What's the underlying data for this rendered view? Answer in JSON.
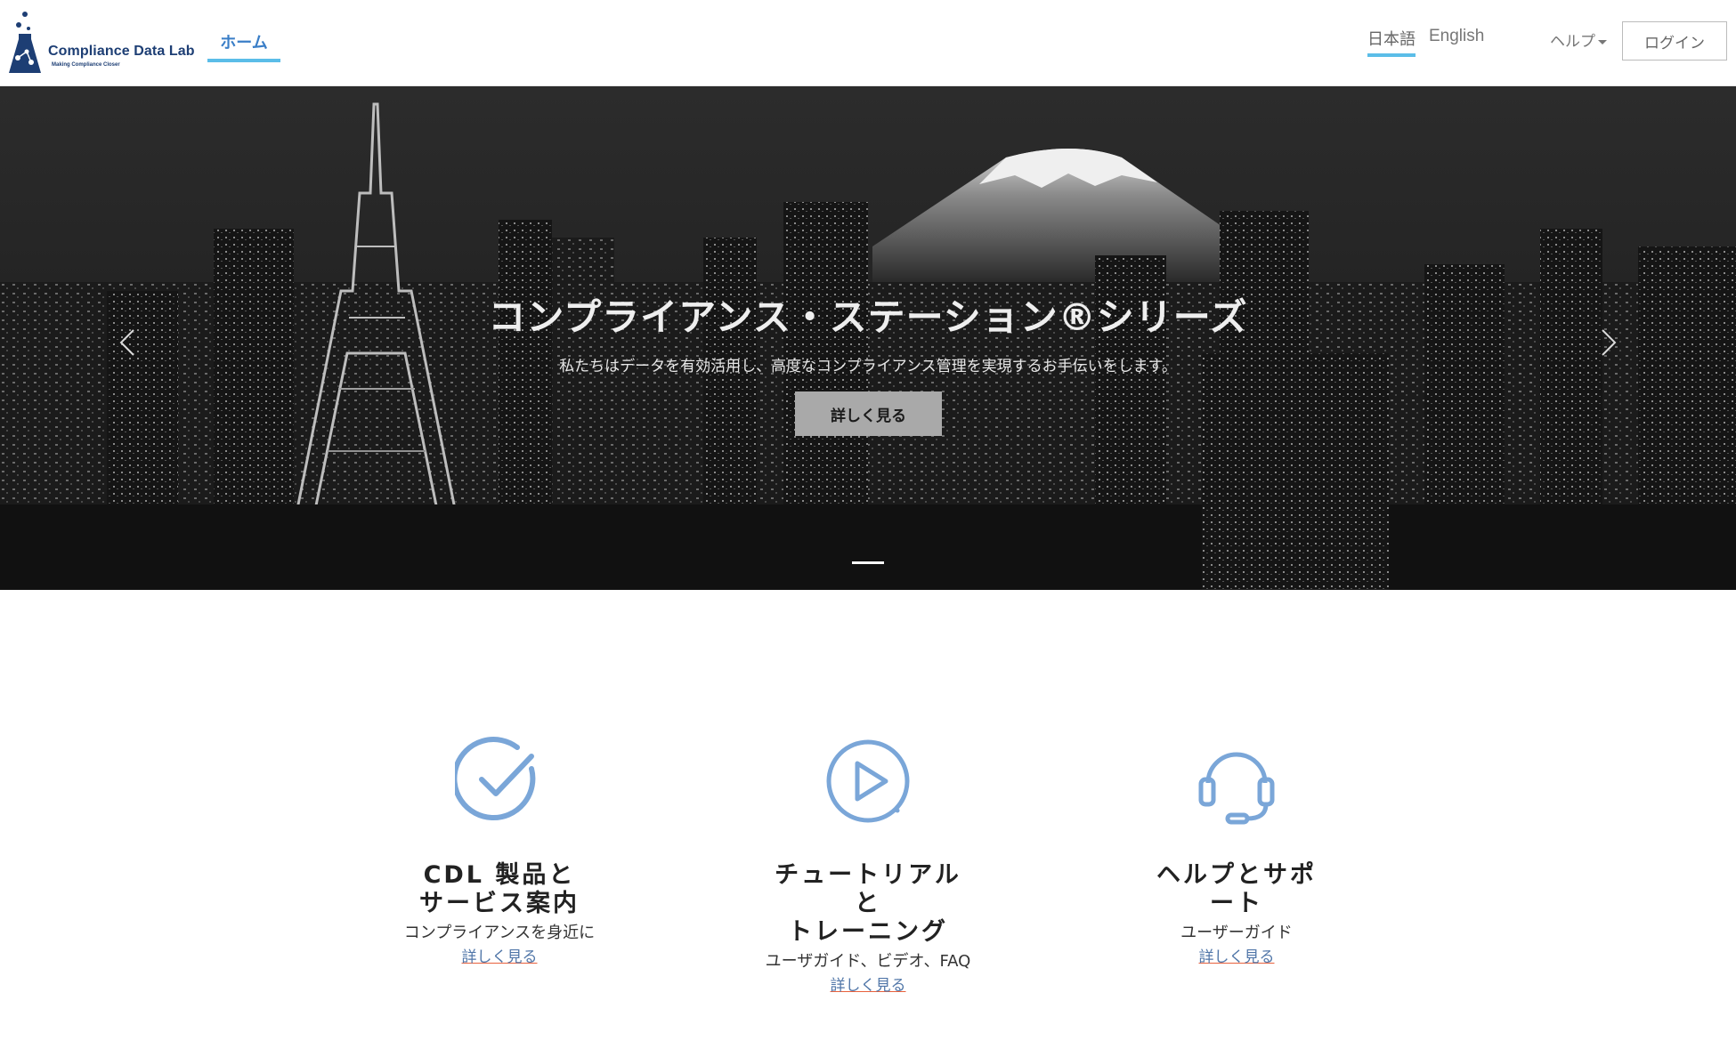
{
  "header": {
    "logo_name": "Compliance Data Lab",
    "logo_tagline": "Making Compliance Closer",
    "nav_home": "ホーム",
    "lang_ja": "日本語",
    "lang_en": "English",
    "help": "ヘルプ",
    "login": "ログイン",
    "accent_color": "#5bbde8",
    "brand_color": "#1d3e74"
  },
  "hero": {
    "title": "コンプライアンス・ステーション®シリーズ",
    "subtitle": "私たちはデータを有効活用し、高度なコンプライアンス管理を実現するお手伝いをします。",
    "button": "詳しく見る",
    "prev_icon": "chevron-left-icon",
    "next_icon": "chevron-right-icon",
    "slide_count": 1,
    "active_slide": 1
  },
  "features": [
    {
      "icon": "check-circle-icon",
      "title": "CDL 製品と\nサービス案内",
      "desc": "コンプライアンスを身近に",
      "link": "詳しく見る"
    },
    {
      "icon": "play-circle-icon",
      "title": "チュートリアル\nと\nトレーニング",
      "desc": "ユーザガイド、ビデオ、FAQ",
      "link": "詳しく見る"
    },
    {
      "icon": "headset-icon",
      "title": "ヘルプとサポ\nート",
      "desc": "ユーザーガイド",
      "link": "詳しく見る"
    }
  ],
  "icon_color": "#7aa6d8"
}
